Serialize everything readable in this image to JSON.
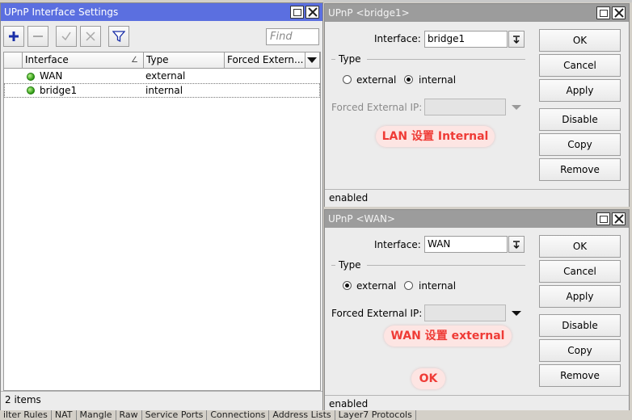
{
  "main": {
    "title": "UPnP Interface Settings",
    "find_placeholder": "Find",
    "columns": [
      "Interface",
      "Type",
      "Forced Extern..."
    ],
    "rows": [
      {
        "interface": "WAN",
        "type": "external",
        "forced": ""
      },
      {
        "interface": "bridge1",
        "type": "internal",
        "forced": ""
      }
    ],
    "status": "2 items"
  },
  "bridge_dialog": {
    "title": "UPnP <bridge1>",
    "interface_label": "Interface:",
    "interface_value": "bridge1",
    "type_group": "Type",
    "external_label": "external",
    "internal_label": "internal",
    "selected_type": "internal",
    "forced_label": "Forced External IP:",
    "forced_value": "",
    "status": "enabled",
    "buttons": {
      "ok": "OK",
      "cancel": "Cancel",
      "apply": "Apply",
      "disable": "Disable",
      "copy": "Copy",
      "remove": "Remove"
    },
    "annotation": "LAN 设置 Internal"
  },
  "wan_dialog": {
    "title": "UPnP <WAN>",
    "interface_label": "Interface:",
    "interface_value": "WAN",
    "type_group": "Type",
    "external_label": "external",
    "internal_label": "internal",
    "selected_type": "external",
    "forced_label": "Forced External IP:",
    "forced_value": "",
    "status": "enabled",
    "buttons": {
      "ok": "OK",
      "cancel": "Cancel",
      "apply": "Apply",
      "disable": "Disable",
      "copy": "Copy",
      "remove": "Remove"
    },
    "annotation": "WAN 设置 external",
    "annotation_ok": "OK"
  },
  "bottom_tabs": [
    "ilter Rules",
    "NAT",
    "Mangle",
    "Raw",
    "Service Ports",
    "Connections",
    "Address Lists",
    "Layer7 Protocols"
  ],
  "colors": {
    "active_title": "#5b6fe0",
    "inactive_title": "#9c9c9c",
    "annotation_text": "#ef3b36",
    "annotation_bg": "#fde5e3",
    "status_ok": "#2e9a12",
    "add_icon": "#1a2fa8"
  }
}
